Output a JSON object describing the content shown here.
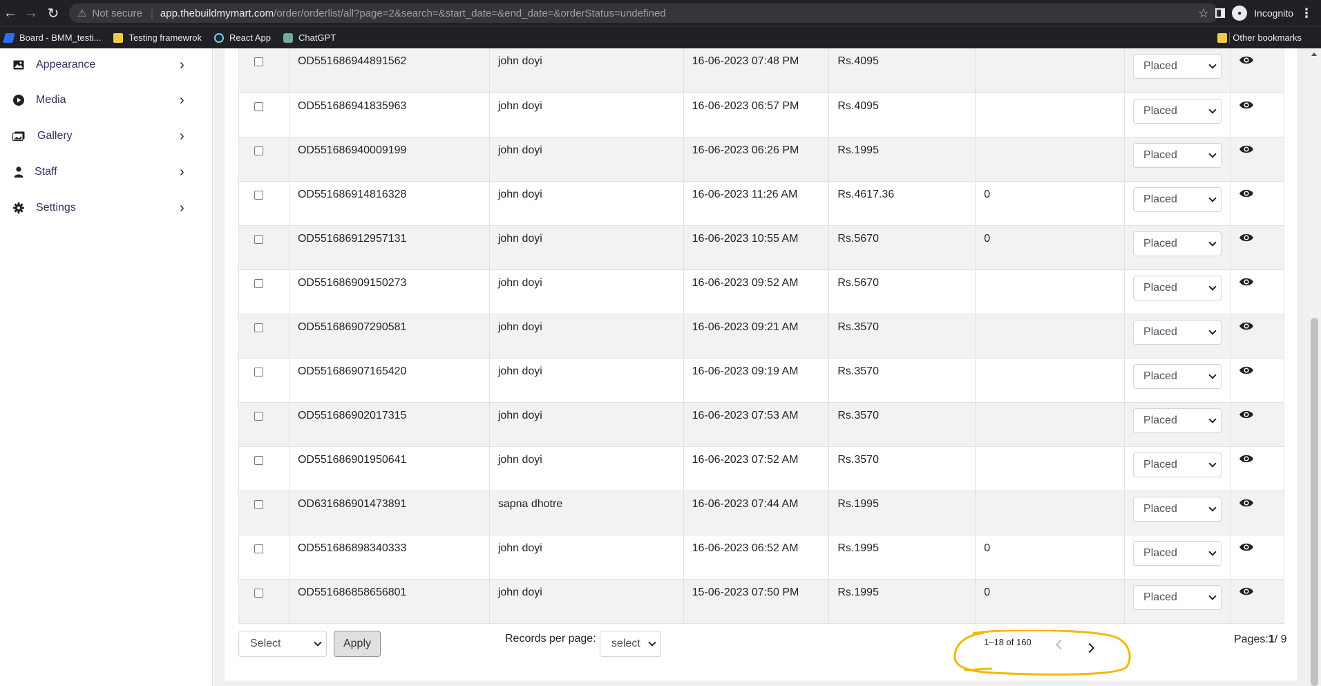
{
  "browser": {
    "security_label": "Not secure",
    "url_host": "app.thebuildmymart.com",
    "url_path": "/order/orderlist/all?page=2&search=&start_date=&end_date=&orderStatus=undefined",
    "profile_label": "Incognito",
    "bookmarks": [
      "Board - BMM_testi...",
      "Testing framewrok",
      "React App",
      "ChatGPT"
    ],
    "other_bookmarks": "Other bookmarks"
  },
  "sidebar": {
    "items": [
      {
        "label": "Appearance",
        "icon": "image-icon"
      },
      {
        "label": "Media",
        "icon": "play-circle-icon"
      },
      {
        "label": "Gallery",
        "icon": "gallery-icon"
      },
      {
        "label": "Staff",
        "icon": "user-icon"
      },
      {
        "label": "Settings",
        "icon": "gear-icon"
      }
    ]
  },
  "orders": [
    {
      "id": "OD551686944891562",
      "customer": "john doyi",
      "date": "16-06-2023 07:48 PM",
      "amount": "Rs.4095",
      "extra": "",
      "status": "Placed"
    },
    {
      "id": "OD551686941835963",
      "customer": "john doyi",
      "date": "16-06-2023 06:57 PM",
      "amount": "Rs.4095",
      "extra": "",
      "status": "Placed"
    },
    {
      "id": "OD551686940009199",
      "customer": "john doyi",
      "date": "16-06-2023 06:26 PM",
      "amount": "Rs.1995",
      "extra": "",
      "status": "Placed"
    },
    {
      "id": "OD551686914816328",
      "customer": "john doyi",
      "date": "16-06-2023 11:26 AM",
      "amount": "Rs.4617.36",
      "extra": "0",
      "status": "Placed"
    },
    {
      "id": "OD551686912957131",
      "customer": "john doyi",
      "date": "16-06-2023 10:55 AM",
      "amount": "Rs.5670",
      "extra": "0",
      "status": "Placed"
    },
    {
      "id": "OD551686909150273",
      "customer": "john doyi",
      "date": "16-06-2023 09:52 AM",
      "amount": "Rs.5670",
      "extra": "",
      "status": "Placed"
    },
    {
      "id": "OD551686907290581",
      "customer": "john doyi",
      "date": "16-06-2023 09:21 AM",
      "amount": "Rs.3570",
      "extra": "",
      "status": "Placed"
    },
    {
      "id": "OD551686907165420",
      "customer": "john doyi",
      "date": "16-06-2023 09:19 AM",
      "amount": "Rs.3570",
      "extra": "",
      "status": "Placed"
    },
    {
      "id": "OD551686902017315",
      "customer": "john doyi",
      "date": "16-06-2023 07:53 AM",
      "amount": "Rs.3570",
      "extra": "",
      "status": "Placed"
    },
    {
      "id": "OD551686901950641",
      "customer": "john doyi",
      "date": "16-06-2023 07:52 AM",
      "amount": "Rs.3570",
      "extra": "",
      "status": "Placed"
    },
    {
      "id": "OD631686901473891",
      "customer": "sapna dhotre",
      "date": "16-06-2023 07:44 AM",
      "amount": "Rs.1995",
      "extra": "",
      "status": "Placed"
    },
    {
      "id": "OD551686898340333",
      "customer": "john doyi",
      "date": "16-06-2023 06:52 AM",
      "amount": "Rs.1995",
      "extra": "0",
      "status": "Placed"
    },
    {
      "id": "OD551686858656801",
      "customer": "john doyi",
      "date": "15-06-2023 07:50 PM",
      "amount": "Rs.1995",
      "extra": "0",
      "status": "Placed"
    }
  ],
  "footer": {
    "bulk_select": "Select",
    "apply_label": "Apply",
    "rpp_label": "Records per page:",
    "rpp_value": "select",
    "range_text": "1–18 of 160",
    "pages_prefix": "Pages:",
    "pages_current": "1",
    "pages_total": "/ 9"
  },
  "colors": {
    "highlight": "#f5b800",
    "sidebar_text": "#3b2f63",
    "stripe": "#f2f2f2"
  }
}
